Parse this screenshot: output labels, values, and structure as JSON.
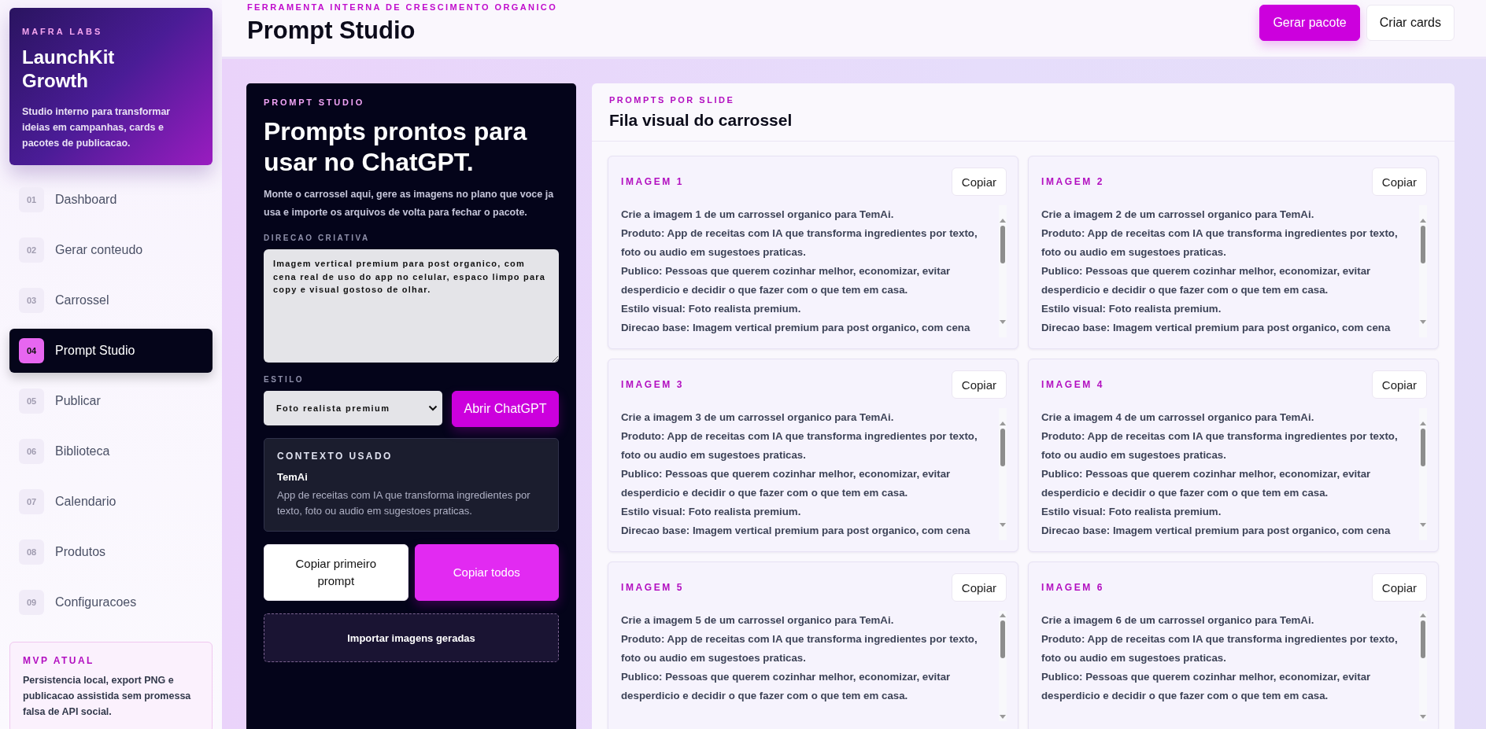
{
  "sidebar": {
    "brand": {
      "eyebrow": "MAFRA LABS",
      "title": "LaunchKit Growth",
      "description": "Studio interno para transformar ideias em campanhas, cards e pacotes de publicacao."
    },
    "items": [
      {
        "number": "01",
        "label": "Dashboard",
        "selected": false
      },
      {
        "number": "02",
        "label": "Gerar conteudo",
        "selected": false
      },
      {
        "number": "03",
        "label": "Carrossel",
        "selected": false
      },
      {
        "number": "04",
        "label": "Prompt Studio",
        "selected": true
      },
      {
        "number": "05",
        "label": "Publicar",
        "selected": false
      },
      {
        "number": "06",
        "label": "Biblioteca",
        "selected": false
      },
      {
        "number": "07",
        "label": "Calendario",
        "selected": false
      },
      {
        "number": "08",
        "label": "Produtos",
        "selected": false
      },
      {
        "number": "09",
        "label": "Configuracoes",
        "selected": false
      }
    ],
    "note": {
      "title": "MVP ATUAL",
      "text": "Persistencia local, export PNG e publicacao assistida sem promessa falsa de API social."
    }
  },
  "header": {
    "eyebrow": "FERRAMENTA INTERNA DE CRESCIMENTO ORGANICO",
    "title": "Prompt Studio",
    "buttons": [
      {
        "label": "Gerar pacote",
        "kind": "primary"
      },
      {
        "label": "Criar cards",
        "kind": "secondary"
      }
    ]
  },
  "studio": {
    "eyebrow": "PROMPT STUDIO",
    "title": "Prompts prontos para usar no ChatGPT.",
    "description": "Monte o carrossel aqui, gere as imagens no plano que voce ja usa e importe os arquivos de volta para fechar o pacote.",
    "direction": {
      "label": "DIRECAO CRIATIVA",
      "value": "Imagem vertical premium para post organico, com cena real de uso do app no celular, espaco limpo para copy e visual gostoso de olhar."
    },
    "style": {
      "label": "ESTILO",
      "value": "Foto realista premium"
    },
    "open_button": "Abrir ChatGPT",
    "context": {
      "title": "CONTEXTO USADO",
      "product": "TemAi",
      "description": "App de receitas com IA que transforma ingredientes por texto, foto ou audio em sugestoes praticas."
    },
    "actions": [
      {
        "label": "Copiar primeiro prompt",
        "kind": "secondary"
      },
      {
        "label": "Copiar todos",
        "kind": "primary"
      }
    ],
    "import_button": "Importar imagens geradas"
  },
  "queue": {
    "eyebrow": "PROMPTS POR SLIDE",
    "title": "Fila visual do carrossel",
    "cards": [
      {
        "title": "IMAGEM 1",
        "button": "Copiar",
        "prompt": [
          "Crie a imagem 1 de um carrossel organico para TemAi.",
          "Produto: App de receitas com IA que transforma ingredientes por texto, foto ou audio em sugestoes praticas.",
          "Publico: Pessoas que querem cozinhar melhor, economizar, evitar desperdicio e decidir o que fazer com o que tem em casa.",
          "Estilo visual: Foto realista premium.",
          "Direcao base: Imagem vertical premium para post organico, com cena"
        ]
      },
      {
        "title": "IMAGEM 2",
        "button": "Copiar",
        "prompt": [
          "Crie a imagem 2 de um carrossel organico para TemAi.",
          "Produto: App de receitas com IA que transforma ingredientes por texto, foto ou audio em sugestoes praticas.",
          "Publico: Pessoas que querem cozinhar melhor, economizar, evitar desperdicio e decidir o que fazer com o que tem em casa.",
          "Estilo visual: Foto realista premium.",
          "Direcao base: Imagem vertical premium para post organico, com cena"
        ]
      },
      {
        "title": "IMAGEM 3",
        "button": "Copiar",
        "prompt": [
          "Crie a imagem 3 de um carrossel organico para TemAi.",
          "Produto: App de receitas com IA que transforma ingredientes por texto, foto ou audio em sugestoes praticas.",
          "Publico: Pessoas que querem cozinhar melhor, economizar, evitar desperdicio e decidir o que fazer com o que tem em casa.",
          "Estilo visual: Foto realista premium.",
          "Direcao base: Imagem vertical premium para post organico, com cena"
        ]
      },
      {
        "title": "IMAGEM 4",
        "button": "Copiar",
        "prompt": [
          "Crie a imagem 4 de um carrossel organico para TemAi.",
          "Produto: App de receitas com IA que transforma ingredientes por texto, foto ou audio em sugestoes praticas.",
          "Publico: Pessoas que querem cozinhar melhor, economizar, evitar desperdicio e decidir o que fazer com o que tem em casa.",
          "Estilo visual: Foto realista premium.",
          "Direcao base: Imagem vertical premium para post organico, com cena"
        ]
      },
      {
        "title": "IMAGEM 5",
        "button": "Copiar",
        "prompt": [
          "Crie a imagem 5 de um carrossel organico para TemAi.",
          "Produto: App de receitas com IA que transforma ingredientes por texto, foto ou audio em sugestoes praticas.",
          "Publico: Pessoas que querem cozinhar melhor, economizar, evitar desperdicio e decidir o que fazer com o que tem em casa."
        ]
      },
      {
        "title": "IMAGEM 6",
        "button": "Copiar",
        "prompt": [
          "Crie a imagem 6 de um carrossel organico para TemAi.",
          "Produto: App de receitas com IA que transforma ingredientes por texto, foto ou audio em sugestoes praticas.",
          "Publico: Pessoas que querem cozinhar melhor, economizar, evitar desperdicio e decidir o que fazer com o que tem em casa."
        ]
      }
    ]
  }
}
